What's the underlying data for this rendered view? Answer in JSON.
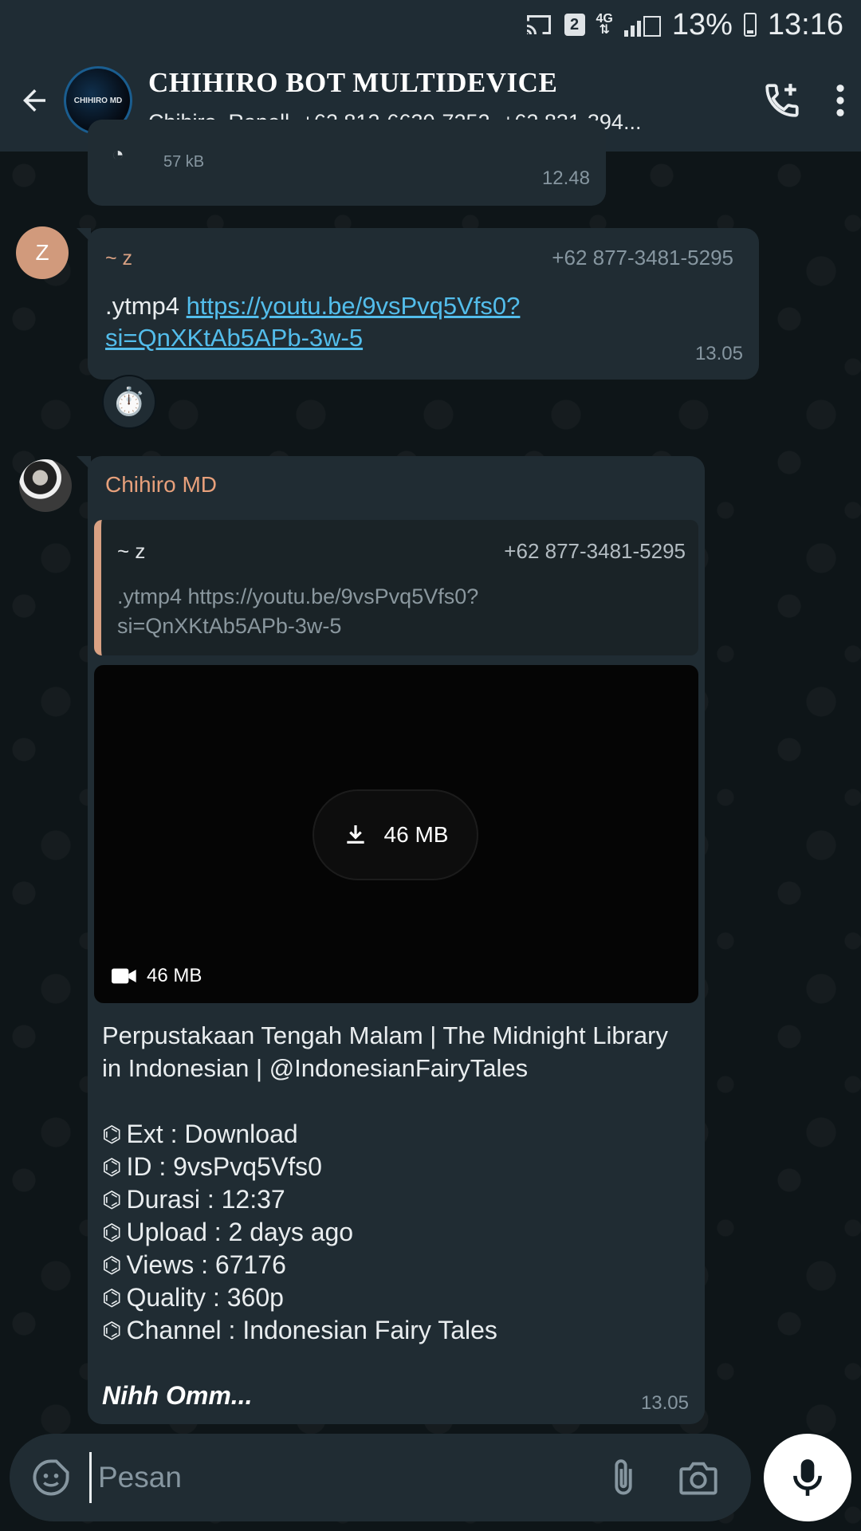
{
  "status_bar": {
    "sim_slot": "2",
    "network": "4G",
    "battery_percent": "13%",
    "time": "13:16",
    "icons": [
      "cast-icon",
      "sim-icon",
      "network-4g-icon",
      "signal-icon",
      "battery-icon"
    ]
  },
  "header": {
    "avatar_text": "CHIHIRO MD",
    "title": "CHIHIRO BOT MULTIDEVICE",
    "subtitle": "Chihiro, Rapell, +62 812-6630-7252, +62 831-394...",
    "icons": [
      "back-arrow-icon",
      "add-call-icon",
      "more-vert-icon"
    ]
  },
  "messages": [
    {
      "size": "57 kB",
      "time": "12.48"
    },
    {
      "avatar_initial": "Z",
      "sender": "~ z",
      "phone": "+62 877-3481-5295",
      "command": ".ytmp4",
      "link": "https://youtu.be/9vsPvq5Vfs0?si=QnXKtAb5APb-3w-5",
      "time": "13.05",
      "reaction": "⏱️"
    },
    {
      "sender": "Chihiro MD",
      "quote": {
        "sender": "~ z",
        "phone": "+62 877-3481-5295",
        "text": ".ytmp4 https://youtu.be/9vsPvq5Vfs0?si=QnXKtAb5APb-3w-5"
      },
      "video": {
        "download_size": "46 MB",
        "meta_size": "46 MB"
      },
      "caption": "Perpustakaan Tengah Malam | The Midnight Library in Indonesian | @IndonesianFairyTales",
      "info": [
        "Ext : Download",
        "ID : 9vsPvq5Vfs0",
        "Durasi : 12:37",
        "Upload : 2 days ago",
        "Views : 67176",
        "Quality : 360p",
        "Channel : Indonesian Fairy Tales"
      ],
      "closing": "Nihh Omm...",
      "time": "13.05"
    }
  ],
  "composer": {
    "placeholder": "Pesan",
    "icons": [
      "sticker-icon",
      "attach-icon",
      "camera-icon",
      "mic-icon"
    ]
  },
  "colors": {
    "background": "#0b141a",
    "bar": "#1f2c34",
    "bubble": "#202c33",
    "link": "#53bdeb",
    "sender_bot": "#e7a07b",
    "quote_accent": "#d9a183"
  }
}
